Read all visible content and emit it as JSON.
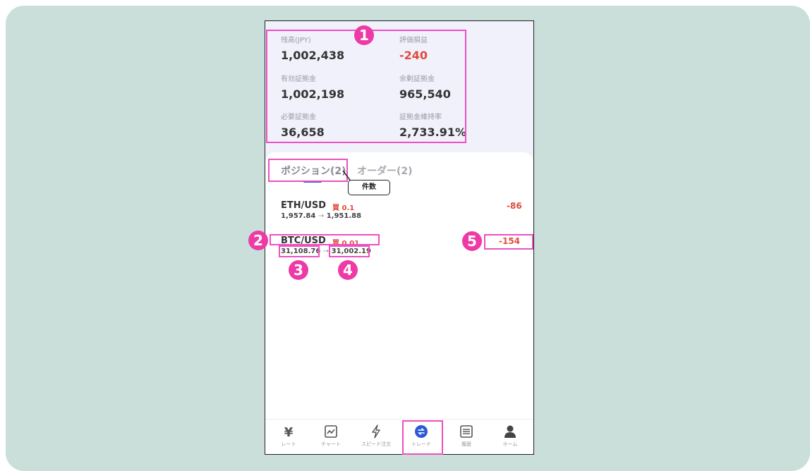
{
  "summary": {
    "balance": {
      "label": "残高(JPY)",
      "value": "1,002,438"
    },
    "pl": {
      "label": "評価損益",
      "value": "-240"
    },
    "effective_margin": {
      "label": "有効証拠金",
      "value": "1,002,198"
    },
    "surplus_margin": {
      "label": "余剰証拠金",
      "value": "965,540"
    },
    "required_margin": {
      "label": "必要証拠金",
      "value": "36,658"
    },
    "margin_ratio": {
      "label": "証拠金維持率",
      "value": "2,733.91%"
    }
  },
  "tabs": [
    {
      "label": "ポジション(2)",
      "active": true
    },
    {
      "label": "オーダー(2)",
      "active": false
    }
  ],
  "tooltip": "件数",
  "positions": [
    {
      "symbol": "ETH/USD",
      "side": "買 0.1",
      "open": "1,957.84",
      "arrow": "→",
      "current": "1,951.88",
      "pl": "-86"
    },
    {
      "symbol": "BTC/USD",
      "side": "買 0.01",
      "open": "31,108.76",
      "arrow": "→",
      "current": "31,002.19",
      "pl": "-154"
    }
  ],
  "nav": [
    {
      "label": "レート",
      "icon": "rate-icon"
    },
    {
      "label": "チャート",
      "icon": "chart-icon"
    },
    {
      "label": "スピード注文",
      "icon": "lightning-icon"
    },
    {
      "label": "トレード",
      "icon": "trade-icon"
    },
    {
      "label": "履歴",
      "icon": "history-icon"
    },
    {
      "label": "ホーム",
      "icon": "person-icon"
    }
  ],
  "markers": [
    "1",
    "2",
    "3",
    "4",
    "5"
  ],
  "colors": {
    "accent": "#2a5bd7",
    "negative": "#e04b3c",
    "highlight": "#ee4fc0",
    "marker": "#ee3aa6",
    "background": "#cadfda"
  }
}
